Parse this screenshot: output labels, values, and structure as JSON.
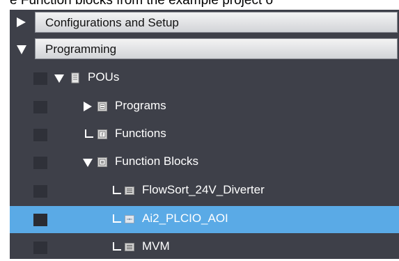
{
  "caption": "e Function blocks from the example project o",
  "sections": [
    {
      "label": "Configurations and Setup",
      "expanded": false
    },
    {
      "label": "Programming",
      "expanded": true
    }
  ],
  "tree": [
    {
      "label": "POUs",
      "icon": "document-icon"
    },
    {
      "label": "Programs",
      "icon": "program-folder-icon"
    },
    {
      "label": "Functions",
      "icon": "function-folder-icon"
    },
    {
      "label": "Function Blocks",
      "icon": "function-block-folder-icon"
    },
    {
      "label": "FlowSort_24V_Diverter",
      "icon": "function-block-icon"
    },
    {
      "label": "Ai2_PLCIO_AOI",
      "icon": "function-block-icon"
    },
    {
      "label": "MVM",
      "icon": "function-block-icon"
    }
  ],
  "colors": {
    "panel": "#3e4049",
    "selection": "#5aaae6"
  }
}
